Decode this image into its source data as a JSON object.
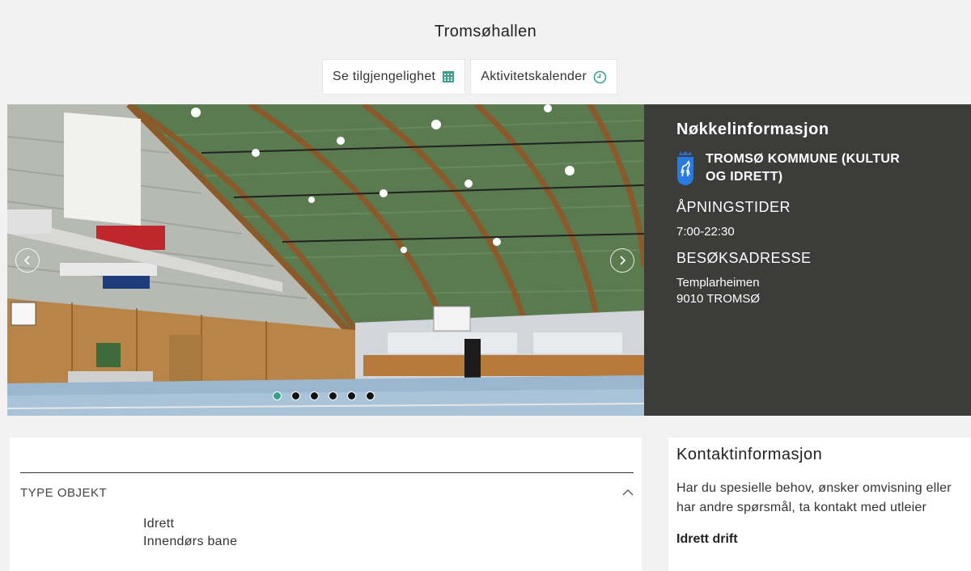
{
  "page": {
    "title": "Tromsøhallen"
  },
  "actions": {
    "availability_label": "Se tilgjengelighet",
    "calendar_label": "Aktivitetskalender",
    "accent": "#3ba08a"
  },
  "carousel": {
    "slide_count": 6,
    "active_index": 0
  },
  "keyinfo": {
    "heading": "Nøkkelinformasjon",
    "owner_line1": "TROMSØ KOMMUNE (KULTUR",
    "owner_line2": "OG IDRETT)",
    "hours_label": "ÅPNINGSTIDER",
    "hours_value": "7:00-22:30",
    "address_label": "BESØKSADRESSE",
    "address_line1": "Templarheimen",
    "address_line2": "9010 TROMSØ"
  },
  "details": {
    "type_header": "TYPE OBJEKT",
    "types": [
      "Idrett",
      "Innendørs bane"
    ]
  },
  "contact": {
    "heading": "Kontaktinformasjon",
    "text": "Har du spesielle behov, ønsker omvisning eller har andre spørsmål, ta kontakt med utleier",
    "department": "Idrett drift"
  }
}
